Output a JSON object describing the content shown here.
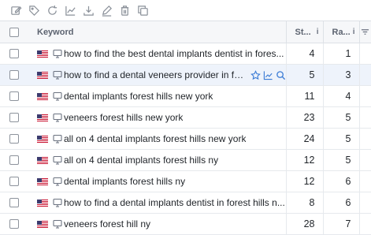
{
  "toolbar": {
    "icons": [
      "edit-icon",
      "tag-icon",
      "refresh-icon",
      "chart-icon",
      "download-icon",
      "pencil-icon",
      "trash-icon",
      "copy-icon"
    ]
  },
  "table": {
    "columns": {
      "keyword": "Keyword",
      "st": "St...",
      "st_info": "i",
      "ra": "Ra...",
      "ra_info": "i"
    },
    "rows": [
      {
        "keyword": "how to find the best dental implants dentist in fores...",
        "st": "4",
        "ra": "1"
      },
      {
        "keyword": "how to find a dental veneers provider in for...",
        "st": "5",
        "ra": "3",
        "highlighted": true
      },
      {
        "keyword": "dental implants forest hills new york",
        "st": "11",
        "ra": "4"
      },
      {
        "keyword": "veneers forest hills new york",
        "st": "23",
        "ra": "5"
      },
      {
        "keyword": "all on 4 dental implants forest hills new york",
        "st": "24",
        "ra": "5"
      },
      {
        "keyword": "all on 4 dental implants forest hills ny",
        "st": "12",
        "ra": "5"
      },
      {
        "keyword": "dental implants forest hills ny",
        "st": "12",
        "ra": "6"
      },
      {
        "keyword": "how to find a dental implants dentist in forest hills n...",
        "st": "8",
        "ra": "6"
      },
      {
        "keyword": "veneers forest hill ny",
        "st": "28",
        "ra": "7"
      }
    ]
  }
}
